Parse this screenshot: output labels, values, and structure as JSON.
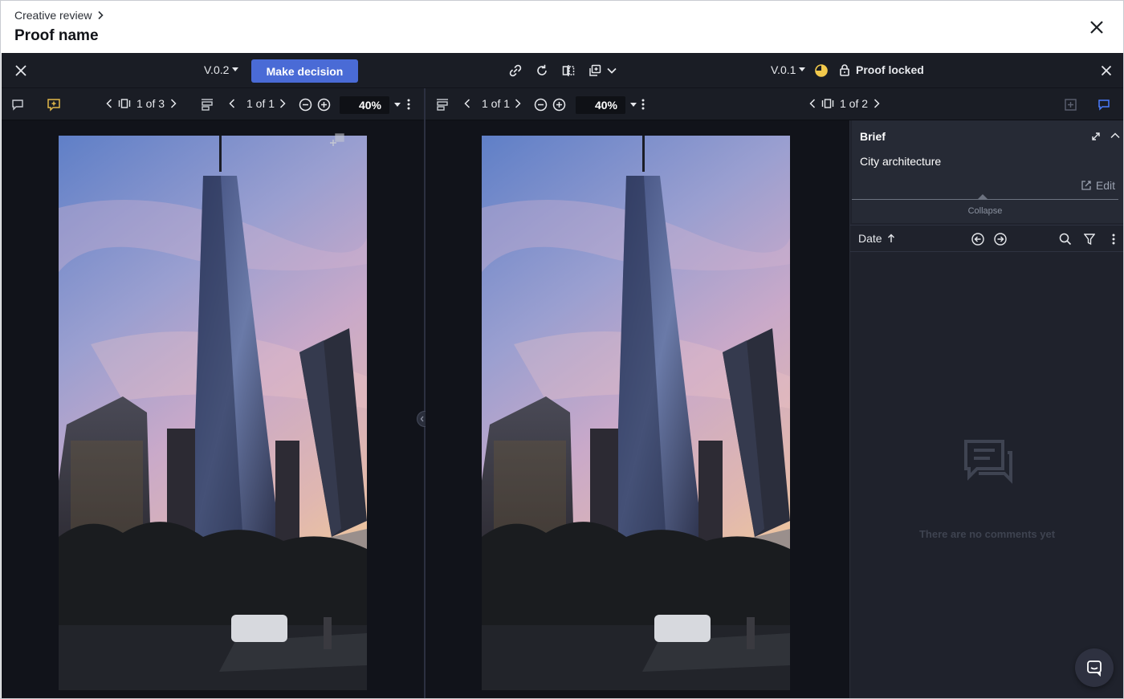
{
  "header": {
    "breadcrumb": "Creative review",
    "title": "Proof name"
  },
  "toolbar": {
    "left_version": "V.0.2",
    "make_decision": "Make decision",
    "right_version": "V.0.1",
    "proof_locked": "Proof locked"
  },
  "left_pane": {
    "page_counter": "1 of 3",
    "frame_counter": "1 of 1",
    "zoom": "40%"
  },
  "right_pane": {
    "frame_counter": "1 of 1",
    "zoom": "40%",
    "page_counter": "1 of 2"
  },
  "sidebar": {
    "brief_title": "Brief",
    "brief_text": "City architecture",
    "edit_label": "Edit",
    "collapse_label": "Collapse",
    "sort_label": "Date",
    "empty_state": "There are no comments yet"
  },
  "colors": {
    "accent": "#4a6bd6",
    "status_yellow": "#f2c94c",
    "highlight_icon": "#e2b84a",
    "active_comment_icon": "#4a7dff"
  },
  "icons": [
    "chevron-right-icon",
    "close-icon",
    "link-icon",
    "refresh-icon",
    "compare-icon",
    "duplicate-icon",
    "chevron-down-icon",
    "status-pie-icon",
    "lock-icon",
    "comment-icon",
    "add-annotation-icon",
    "filmstrip-icon",
    "align-icon",
    "zoom-out-icon",
    "zoom-in-icon",
    "more-icon",
    "expand-icon",
    "edit-icon",
    "arrow-up-icon",
    "prev-circle-icon",
    "next-circle-icon",
    "search-icon",
    "filter-icon",
    "chat-icon"
  ]
}
